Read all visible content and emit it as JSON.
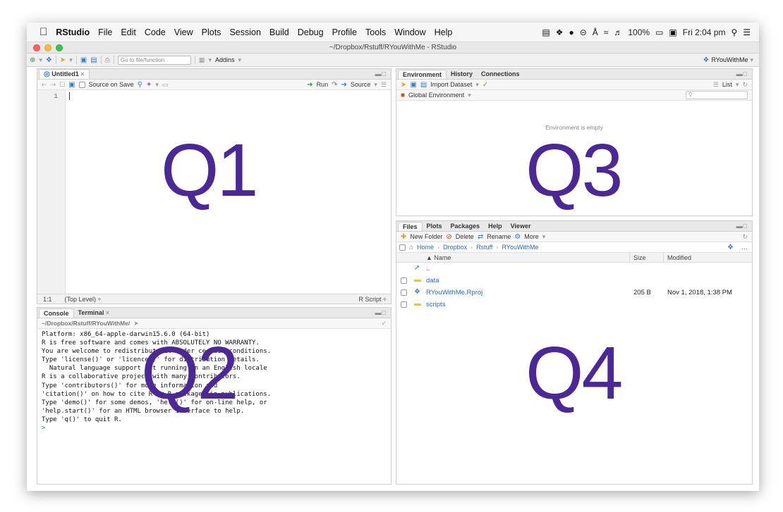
{
  "menubar": {
    "app": "RStudio",
    "items": [
      "File",
      "Edit",
      "Code",
      "View",
      "Plots",
      "Session",
      "Build",
      "Debug",
      "Profile",
      "Tools",
      "Window",
      "Help"
    ],
    "battery": "100%",
    "clock": "Fri 2:04 pm"
  },
  "window": {
    "title": "~/Dropbox/Rstuff/RYouWithMe - RStudio"
  },
  "toolbar": {
    "goto_placeholder": "Go to file/function",
    "addins_label": "Addins",
    "project_label": "RYouWithMe"
  },
  "editor": {
    "tab_label": "Untitled1",
    "source_on_save_label": "Source on Save",
    "run_label": "Run",
    "source_label": "Source",
    "line_number": "1",
    "status_position": "1:1",
    "status_scope": "(Top Level) ÷",
    "status_type": "R Script ÷"
  },
  "console": {
    "tabs": [
      "Console",
      "Terminal"
    ],
    "path": "~/Dropbox/Rstuff/RYouWithMe/",
    "lines": [
      "Platform: x86_64-apple-darwin15.6.0 (64-bit)",
      "",
      "R is free software and comes with ABSOLUTELY NO WARRANTY.",
      "You are welcome to redistribute it under certain conditions.",
      "Type 'license()' or 'licence()' for distribution details.",
      "",
      "  Natural language support but running in an English locale",
      "",
      "R is a collaborative project with many contributors.",
      "Type 'contributors()' for more information and",
      "'citation()' on how to cite R or R packages in publications.",
      "",
      "Type 'demo()' for some demos, 'help()' for on-line help, or",
      "'help.start()' for an HTML browser interface to help.",
      "Type 'q()' to quit R.",
      "",
      ">"
    ]
  },
  "environment": {
    "tabs": [
      "Environment",
      "History",
      "Connections"
    ],
    "import_label": "Import Dataset",
    "list_label": "List",
    "scope_label": "Global Environment",
    "empty_text": "Environment is empty"
  },
  "files": {
    "tabs": [
      "Files",
      "Plots",
      "Packages",
      "Help",
      "Viewer"
    ],
    "new_folder_label": "New Folder",
    "delete_label": "Delete",
    "rename_label": "Rename",
    "more_label": "More",
    "breadcrumb": [
      "Home",
      "Dropbox",
      "Rstuff",
      "RYouWithMe"
    ],
    "columns": {
      "name": "Name",
      "size": "Size",
      "modified": "Modified"
    },
    "up_label": "..",
    "rows": [
      {
        "name": "data",
        "size": "",
        "modified": "",
        "icon": "folder-icon"
      },
      {
        "name": "RYouWithMe.Rproj",
        "size": "205 B",
        "modified": "Nov 1, 2018, 1:38 PM",
        "icon": "rproj-icon"
      },
      {
        "name": "scripts",
        "size": "",
        "modified": "",
        "icon": "folder-icon"
      }
    ]
  },
  "quadrants": {
    "q1": "Q1",
    "q2": "Q2",
    "q3": "Q3",
    "q4": "Q4"
  },
  "colors": {
    "quadrant_label": "#4b2896",
    "link_blue": "#2a6cc0",
    "folder_yellow": "#f2c233"
  }
}
